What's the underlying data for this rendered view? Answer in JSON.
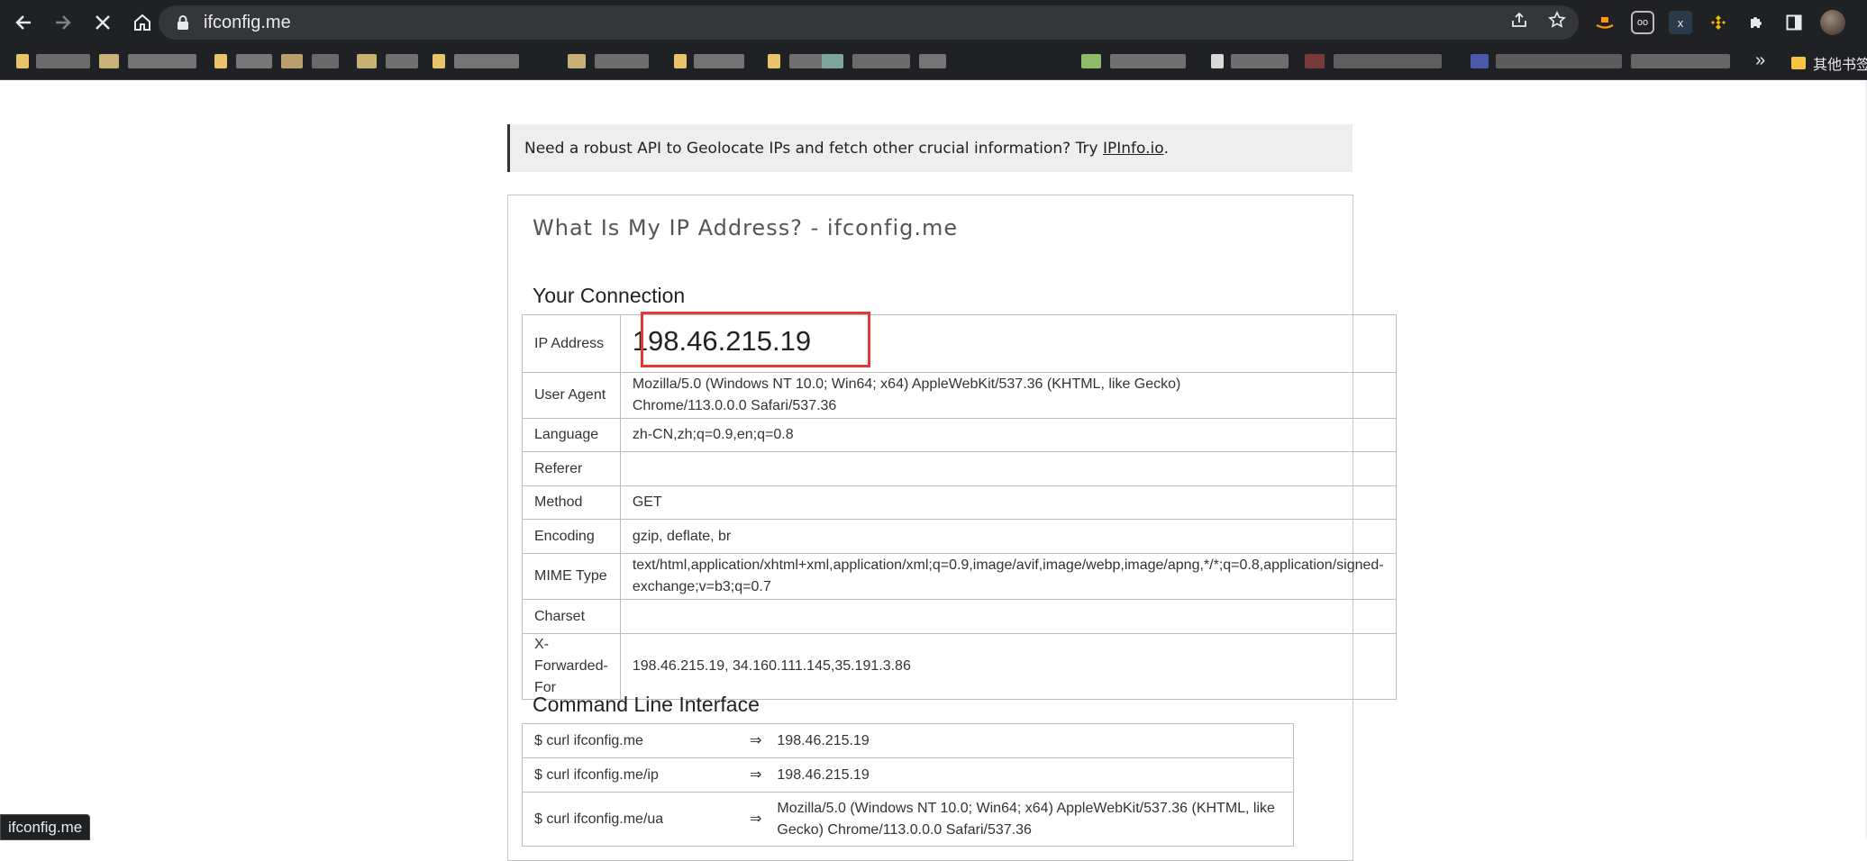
{
  "browser": {
    "url": "ifconfig.me",
    "bookmarks_other_label": "其他书签",
    "bookmarks_more": "»",
    "status_text": "ifconfig.me"
  },
  "banner": {
    "text": "Need a robust API to Geolocate IPs and fetch other crucial information? Try ",
    "link_text": "IPInfo.io",
    "suffix": "."
  },
  "page": {
    "title": "What Is My IP Address? - ifconfig.me"
  },
  "connection": {
    "heading": "Your Connection",
    "rows": [
      {
        "label": "IP Address",
        "value": "198.46.215.19"
      },
      {
        "label": "User Agent",
        "value": "Mozilla/5.0 (Windows NT 10.0; Win64; x64) AppleWebKit/537.36 (KHTML, like Gecko)",
        "value2": "Chrome/113.0.0.0 Safari/537.36"
      },
      {
        "label": "Language",
        "value": "zh-CN,zh;q=0.9,en;q=0.8"
      },
      {
        "label": "Referer",
        "value": ""
      },
      {
        "label": "Method",
        "value": "GET"
      },
      {
        "label": "Encoding",
        "value": "gzip, deflate, br"
      },
      {
        "label": "MIME Type",
        "value": "text/html,application/xhtml+xml,application/xml;q=0.9,image/avif,image/webp,image/apng,*/*;q=0.8,application/signed-",
        "value2": "exchange;v=b3;q=0.7"
      },
      {
        "label": "Charset",
        "value": ""
      },
      {
        "label": "X-Forwarded-For",
        "value": "198.46.215.19, 34.160.111.145,35.191.3.86"
      }
    ]
  },
  "cli": {
    "heading": "Command Line Interface",
    "arrow": "⇒",
    "rows": [
      {
        "cmd": "$ curl ifconfig.me",
        "out": "198.46.215.19"
      },
      {
        "cmd": "$ curl ifconfig.me/ip",
        "out": "198.46.215.19"
      },
      {
        "cmd": "$ curl ifconfig.me/ua",
        "out": "Mozilla/5.0 (Windows NT 10.0; Win64; x64) AppleWebKit/537.36 (KHTML, like",
        "out2": "Gecko) Chrome/113.0.0.0 Safari/537.36"
      }
    ]
  },
  "colors": {
    "chrome_bg": "#202124",
    "omnibox_bg": "#35363a",
    "highlight_box": "#e53935"
  }
}
